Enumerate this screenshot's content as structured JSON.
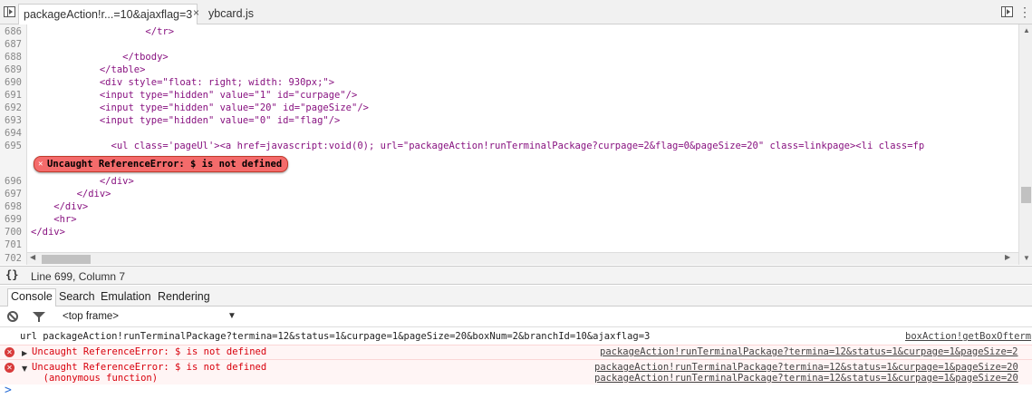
{
  "tabs": [
    {
      "label": "packageAction!r...=10&ajaxflag=3",
      "close": "×"
    },
    {
      "label": "ybcard.js"
    }
  ],
  "editor": {
    "lines": [
      {
        "num": "686",
        "code": "                    </tr>"
      },
      {
        "num": "687",
        "code": ""
      },
      {
        "num": "688",
        "code": "                </tbody>"
      },
      {
        "num": "689",
        "code": "            </table>"
      },
      {
        "num": "690",
        "code": "            <div style=\"float: right; width: 930px;\">"
      },
      {
        "num": "691",
        "code": "            <input type=\"hidden\" value=\"1\" id=\"curpage\"/>"
      },
      {
        "num": "692",
        "code": "            <input type=\"hidden\" value=\"20\" id=\"pageSize\"/>"
      },
      {
        "num": "693",
        "code": "            <input type=\"hidden\" value=\"0\" id=\"flag\"/>"
      },
      {
        "num": "694",
        "code": ""
      },
      {
        "num": "695",
        "code": "              <ul class='pageUl'><a href=javascript:void(0); url=\"packageAction!runTerminalPackage?curpage=2&flag=0&pageSize=20\" class=linkpage><li class=fp"
      },
      {
        "num": "696",
        "code": "            </div>"
      },
      {
        "num": "697",
        "code": "        </div>"
      },
      {
        "num": "698",
        "code": "    </div>"
      },
      {
        "num": "699",
        "code": "    <hr>"
      },
      {
        "num": "700",
        "code": "</div>"
      },
      {
        "num": "701",
        "code": ""
      },
      {
        "num": "702",
        "code": ""
      }
    ],
    "inline_error": "Uncaught ReferenceError: $ is not defined"
  },
  "status": {
    "braces": "{}",
    "position": "Line 699, Column 7"
  },
  "drawer": {
    "tabs": [
      "Console",
      "Search",
      "Emulation",
      "Rendering"
    ]
  },
  "console": {
    "frame": "<top frame>",
    "messages": [
      {
        "type": "log",
        "text": "url packageAction!runTerminalPackage?termina=12&status=1&curpage=1&pageSize=20&boxNum=2&branchId=10&ajaxflag=3",
        "source": "boxAction!getBoxOfterm"
      },
      {
        "type": "error",
        "text": "Uncaught ReferenceError: $ is not defined",
        "source": "packageAction!runTerminalPackage?termina=12&status=1&curpage=1&pageSize=2"
      },
      {
        "type": "error",
        "text": "Uncaught ReferenceError: $ is not defined",
        "text2": "  (anonymous function)",
        "source": "packageAction!runTerminalPackage?termina=12&status=1&curpage=1&pageSize=20",
        "source2": "packageAction!runTerminalPackage?termina=12&status=1&curpage=1&pageSize=20"
      }
    ],
    "prompt": ">"
  },
  "colors": {
    "error": "#d8000c",
    "error_bubble": "#f46b6b",
    "tag": "#881280",
    "link": "#1a1aa6"
  }
}
